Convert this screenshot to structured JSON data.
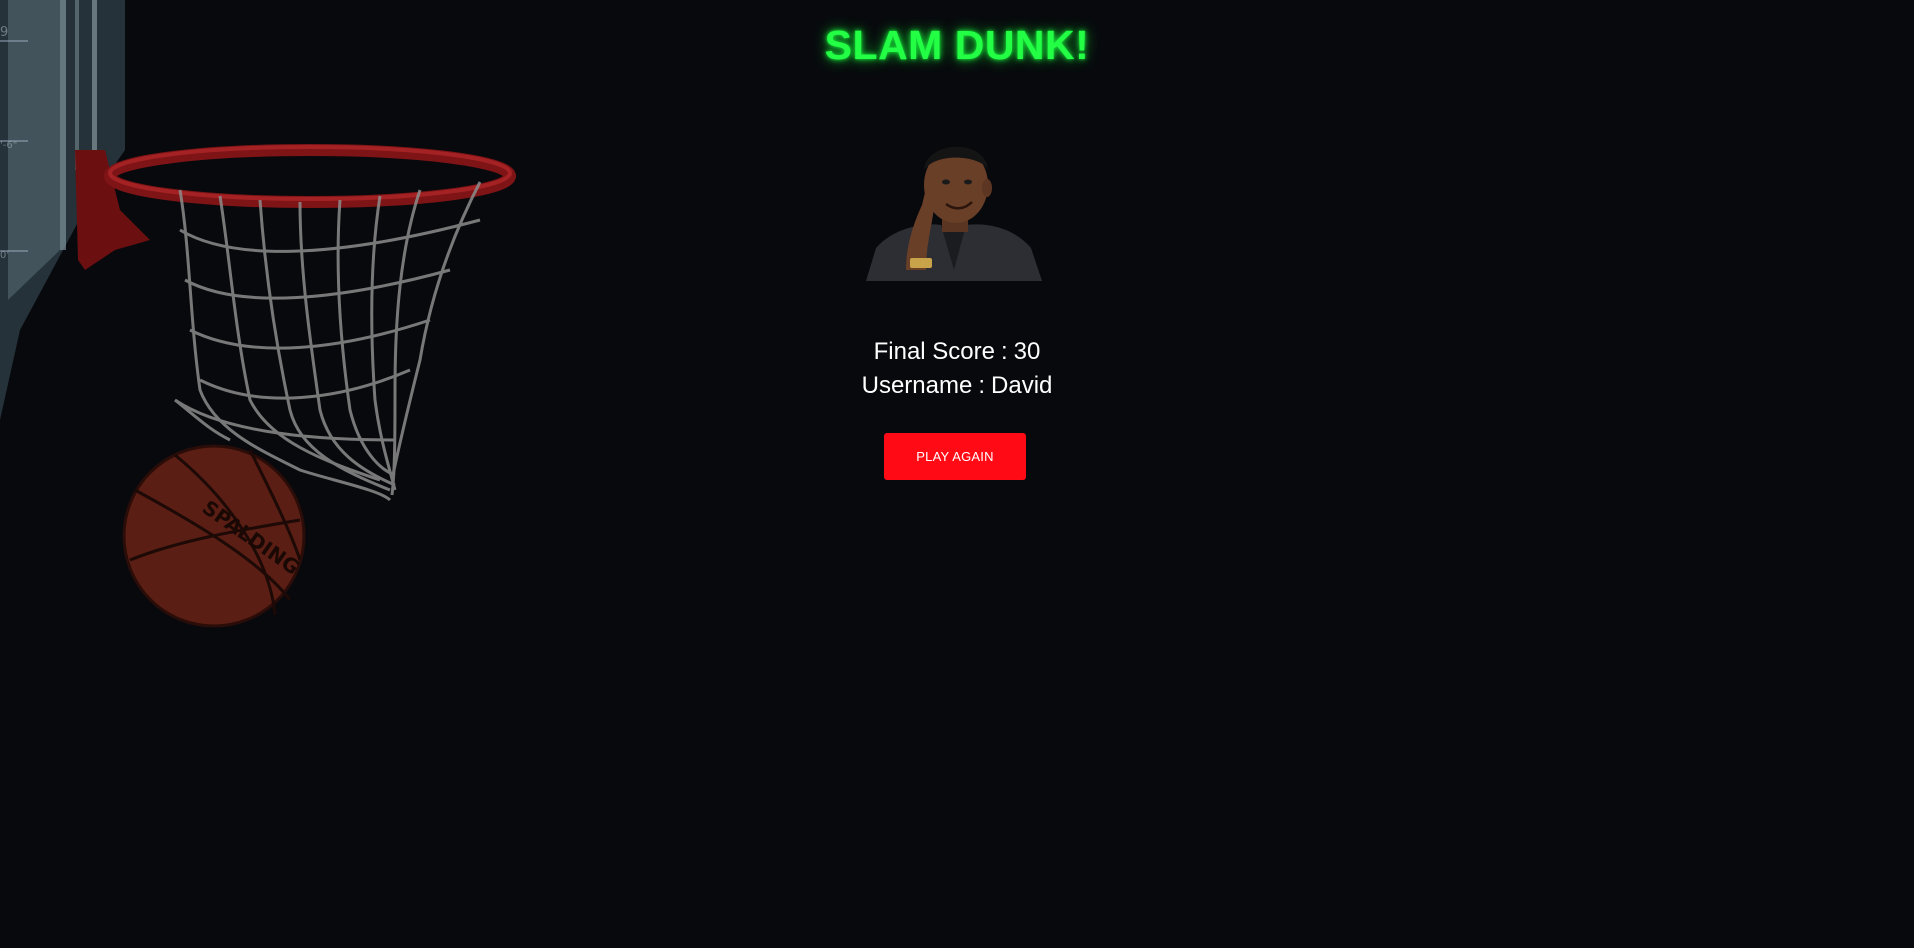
{
  "game": {
    "title": "SLAM DUNK!",
    "avatar_alt": "meme-avatar",
    "final_score_label": "Final Score",
    "final_score_value": "30",
    "username_label": "Username",
    "username_value": "David",
    "separator": ":",
    "play_again_label": "PLAY AGAIN"
  },
  "colors": {
    "background": "#08090d",
    "title_glow": "#22ff44",
    "button": "#ff0a15",
    "text": "#ffffff"
  },
  "background_art": {
    "icons": [
      "basketball-hoop-icon",
      "basketball-net-icon",
      "basketball-icon",
      "backboard-icon"
    ],
    "ball_brand_text": "SPALDING"
  }
}
